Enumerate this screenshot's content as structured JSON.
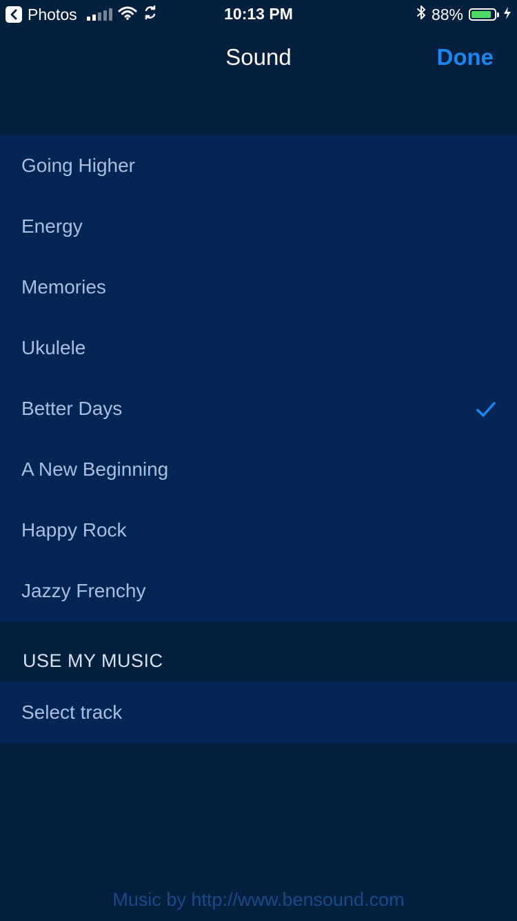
{
  "status_bar": {
    "back_app": "Photos",
    "time": "10:13 PM",
    "battery_percent": "88%",
    "battery_level": 0.88,
    "icons": [
      "chevron-left-icon",
      "signal-icon",
      "wifi-icon",
      "sync-icon",
      "bluetooth-icon",
      "battery-icon",
      "charging-icon"
    ]
  },
  "nav": {
    "title": "Sound",
    "done_label": "Done"
  },
  "colors": {
    "background": "#03213f",
    "list_background": "#032655",
    "accent": "#1b86f0",
    "item_text": "#a9bfdd",
    "battery_fill": "#4cd964"
  },
  "sounds": {
    "items": [
      {
        "label": "Going Higher",
        "selected": false
      },
      {
        "label": "Energy",
        "selected": false
      },
      {
        "label": "Memories",
        "selected": false
      },
      {
        "label": "Ukulele",
        "selected": false
      },
      {
        "label": "Better Days",
        "selected": true
      },
      {
        "label": "A New Beginning",
        "selected": false
      },
      {
        "label": "Happy Rock",
        "selected": false
      },
      {
        "label": "Jazzy Frenchy",
        "selected": false
      }
    ]
  },
  "my_music": {
    "header": "USE MY MUSIC",
    "select_label": "Select track"
  },
  "footer": {
    "credit": "Music by http://www.bensound.com"
  }
}
